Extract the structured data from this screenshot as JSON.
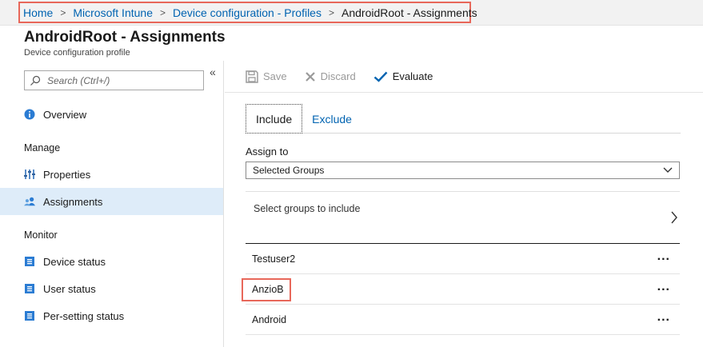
{
  "breadcrumb": {
    "items": [
      "Home",
      "Microsoft Intune",
      "Device configuration - Profiles"
    ],
    "current": "AndroidRoot - Assignments",
    "separator": ">"
  },
  "page": {
    "title": "AndroidRoot - Assignments",
    "subtitle": "Device configuration profile"
  },
  "sidebar": {
    "search_placeholder": "Search (Ctrl+/)",
    "collapse_glyph": "«",
    "overview_label": "Overview",
    "manage_header": "Manage",
    "properties_label": "Properties",
    "assignments_label": "Assignments",
    "monitor_header": "Monitor",
    "device_status_label": "Device status",
    "user_status_label": "User status",
    "per_setting_status_label": "Per-setting status"
  },
  "toolbar": {
    "save_label": "Save",
    "discard_label": "Discard",
    "evaluate_label": "Evaluate"
  },
  "tabs": {
    "include_label": "Include",
    "exclude_label": "Exclude"
  },
  "assign": {
    "label": "Assign to",
    "selected_value": "Selected Groups"
  },
  "select_groups_label": "Select groups to include",
  "groups": [
    "Testuser2",
    "AnzioB",
    "Android"
  ],
  "more_glyph": "...",
  "colors": {
    "accent": "#0063b1",
    "active_nav": "#deecf9",
    "highlight": "#e8675a"
  }
}
